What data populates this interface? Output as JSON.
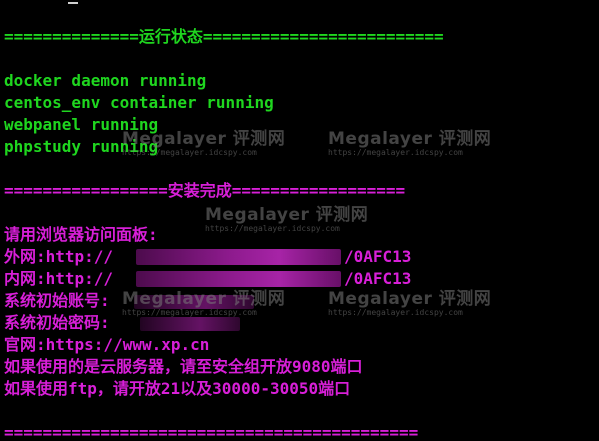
{
  "terminal": {
    "colors": {
      "background": "#000000",
      "green": "#1fd61f",
      "magenta": "#d81fd8"
    },
    "status_header": "==============运行状态=========================",
    "status_lines": [
      "docker daemon running",
      "centos_env container running",
      "webpanel running",
      "phpstudy running"
    ],
    "install_header": "=================安装完成==================",
    "info_lines": {
      "visit_prompt": "请用浏览器访问面板:",
      "external_prefix": "外网:http://",
      "external_suffix": "/0AFC13",
      "internal_prefix": "内网:http://",
      "internal_suffix": "/0AFC13",
      "account_label": "系统初始账号:",
      "password_label": "系统初始密码:",
      "official_site": "官网:https://www.xp.cn",
      "cloud_note": "如果使用的是云服务器，请至安全组开放9080端口",
      "ftp_note": "如果使用ftp，请开放21以及30000-30050端口"
    },
    "footer_rule": "==========================================="
  },
  "watermark": {
    "brand": "Megalayer 评测网",
    "url": "https://megalayer.idcspy.com"
  }
}
